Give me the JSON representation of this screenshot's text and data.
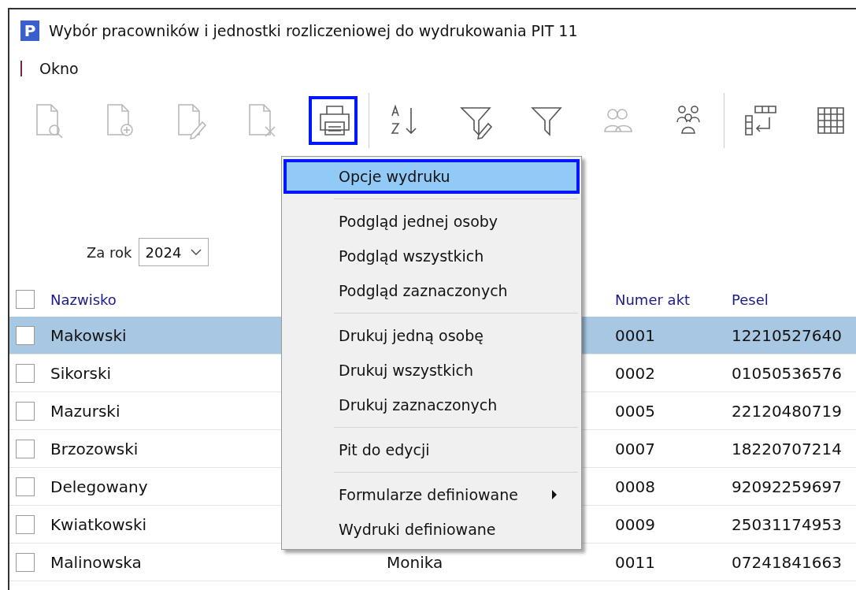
{
  "window": {
    "title": "Wybór pracowników i jednostki rozliczeniowej do wydrukowania PIT 11",
    "logo": "P"
  },
  "menu_bar": {
    "items": [
      {
        "label": "Okno"
      }
    ]
  },
  "toolbar": {
    "groups": [
      [
        {
          "kind": "document-search",
          "disabled": true,
          "focused": false
        },
        {
          "kind": "document-add",
          "disabled": true,
          "focused": false
        },
        {
          "kind": "document-edit",
          "disabled": true,
          "focused": false
        },
        {
          "kind": "document-delete",
          "disabled": true,
          "focused": false
        },
        {
          "kind": "printer",
          "disabled": false,
          "focused": true
        }
      ],
      [
        {
          "kind": "sort",
          "disabled": false,
          "focused": false
        },
        {
          "kind": "filter-edit",
          "disabled": false,
          "focused": false
        },
        {
          "kind": "filter",
          "disabled": false,
          "focused": false
        },
        {
          "kind": "people",
          "disabled": true,
          "focused": false
        },
        {
          "kind": "group",
          "disabled": false,
          "focused": false
        }
      ],
      [
        {
          "kind": "columns",
          "disabled": false,
          "focused": false
        },
        {
          "kind": "grid",
          "disabled": false,
          "focused": false
        }
      ]
    ]
  },
  "year_filter": {
    "label": "Za rok",
    "value": "2024"
  },
  "table": {
    "header_checked": false,
    "columns": {
      "surname": "Nazwisko",
      "number": "Numer akt",
      "pesel": "Pesel"
    },
    "rows": [
      {
        "surname": "Makowski",
        "number": "0001",
        "pesel": "12210527640",
        "selected": true,
        "checked": false
      },
      {
        "surname": "Sikorski",
        "number": "0002",
        "pesel": "01050536576",
        "selected": false,
        "checked": false
      },
      {
        "surname": "Mazurski",
        "number": "0005",
        "pesel": "22120480719",
        "selected": false,
        "checked": false
      },
      {
        "surname": "Brzozowski",
        "number": "0007",
        "pesel": "18220707214",
        "selected": false,
        "checked": false
      },
      {
        "surname": "Delegowany",
        "number": "0008",
        "pesel": "92092259697",
        "selected": false,
        "checked": false
      },
      {
        "surname": "Kwiatkowski",
        "number": "0009",
        "pesel": "25031174953",
        "selected": false,
        "checked": false
      },
      {
        "surname": "Malinowska",
        "column_2": "Monika",
        "number": "0011",
        "pesel": "07241841663",
        "selected": false,
        "checked": false
      }
    ]
  },
  "context_menu": {
    "groups": [
      [
        {
          "label": "Opcje wydruku",
          "selected": true,
          "submenu": false
        }
      ],
      [
        {
          "label": "Podgląd jednej osoby",
          "selected": false,
          "submenu": false
        },
        {
          "label": "Podgląd wszystkich",
          "selected": false,
          "submenu": false
        },
        {
          "label": "Podgląd zaznaczonych",
          "selected": false,
          "submenu": false
        }
      ],
      [
        {
          "label": "Drukuj jedną osobę",
          "selected": false,
          "submenu": false
        },
        {
          "label": "Drukuj wszystkich",
          "selected": false,
          "submenu": false
        },
        {
          "label": "Drukuj zaznaczonych",
          "selected": false,
          "submenu": false
        }
      ],
      [
        {
          "label": "Pit do edycji",
          "selected": false,
          "submenu": false
        }
      ],
      [
        {
          "label": "Formularze definiowane",
          "selected": false,
          "submenu": true
        },
        {
          "label": "Wydruki definiowane",
          "selected": false,
          "submenu": false
        }
      ]
    ]
  }
}
